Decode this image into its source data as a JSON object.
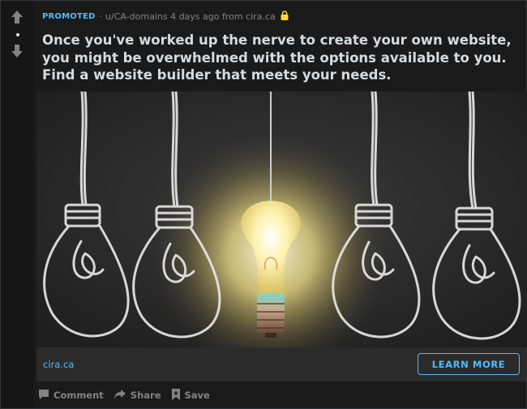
{
  "post": {
    "promoted_label": "PROMOTED",
    "separator": "·",
    "author_line": "u/CA-domains 4 days ago from cira.ca",
    "title": "Once you've worked up the nerve to create your own website, you might be overwhelmed with the options available to you. Find a website builder that meets your needs.",
    "domain": "cira.ca",
    "cta_label": "LEARN MORE"
  },
  "actions": {
    "comment": "Comment",
    "share": "Share",
    "save": "Save"
  },
  "icons": {
    "upvote": "arrow-up-icon",
    "downvote": "arrow-down-icon",
    "lock": "lock-icon",
    "comment": "comment-icon",
    "share": "share-icon",
    "save": "bookmark-icon"
  },
  "colors": {
    "background": "#1a1a1b",
    "accent": "#4fbcff",
    "muted": "#818384",
    "text": "#d7dadc",
    "lock": "#ffd635"
  }
}
